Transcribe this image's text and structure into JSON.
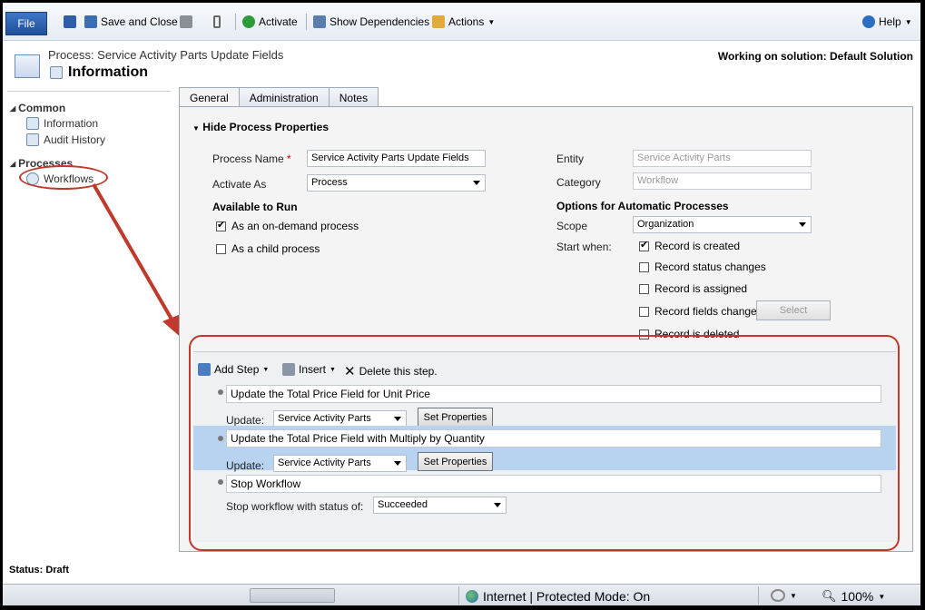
{
  "ribbon": {
    "file_label": "File",
    "save_close_label": "Save and Close",
    "activate_label": "Activate",
    "show_dependencies_label": "Show Dependencies",
    "actions_label": "Actions",
    "help_label": "Help"
  },
  "header": {
    "process_title": "Process: Service Activity Parts Update Fields",
    "page_title": "Information",
    "solution_text": "Working on solution: Default Solution"
  },
  "nav": {
    "common_label": "Common",
    "information_label": "Information",
    "audit_history_label": "Audit History",
    "processes_label": "Processes",
    "workflows_label": "Workflows"
  },
  "tabs": {
    "general": "General",
    "administration": "Administration",
    "notes": "Notes"
  },
  "form": {
    "section_toggle": "Hide Process Properties",
    "process_name_label": "Process Name",
    "required_marker": "*",
    "process_name_value": "Service Activity Parts Update Fields",
    "activate_as_label": "Activate As",
    "activate_as_value": "Process",
    "available_to_run_label": "Available to Run",
    "on_demand_label": "As an on-demand process",
    "child_process_label": "As a child process",
    "entity_label": "Entity",
    "entity_value": "Service Activity Parts",
    "category_label": "Category",
    "category_value": "Workflow",
    "options_label": "Options for Automatic Processes",
    "scope_label": "Scope",
    "scope_value": "Organization",
    "start_when_label": "Start when:",
    "record_created_label": "Record is created",
    "record_status_label": "Record status changes",
    "record_assigned_label": "Record is assigned",
    "record_fields_label": "Record fields change",
    "select_label": "Select",
    "record_deleted_label": "Record is deleted"
  },
  "designer": {
    "add_step_label": "Add Step",
    "insert_label": "Insert",
    "delete_label": "Delete this step.",
    "step1_text": "Update the Total Price Field for Unit Price",
    "step2_text": "Update the Total Price Field with Multiply by Quantity",
    "update_label": "Update:",
    "update_entity": "Service Activity Parts",
    "set_properties_label": "Set Properties",
    "step3_text": "Stop Workflow",
    "stop_status_label": "Stop workflow with status of:",
    "stop_status_value": "Succeeded"
  },
  "status": {
    "text": "Status: Draft"
  },
  "statusbar": {
    "zone_text": "Internet | Protected Mode: On",
    "zoom_text": "100%"
  },
  "colors": {
    "accent": "#1f4f9a",
    "annotation": "#c0392b",
    "selected_step": "#b8d3ef"
  }
}
